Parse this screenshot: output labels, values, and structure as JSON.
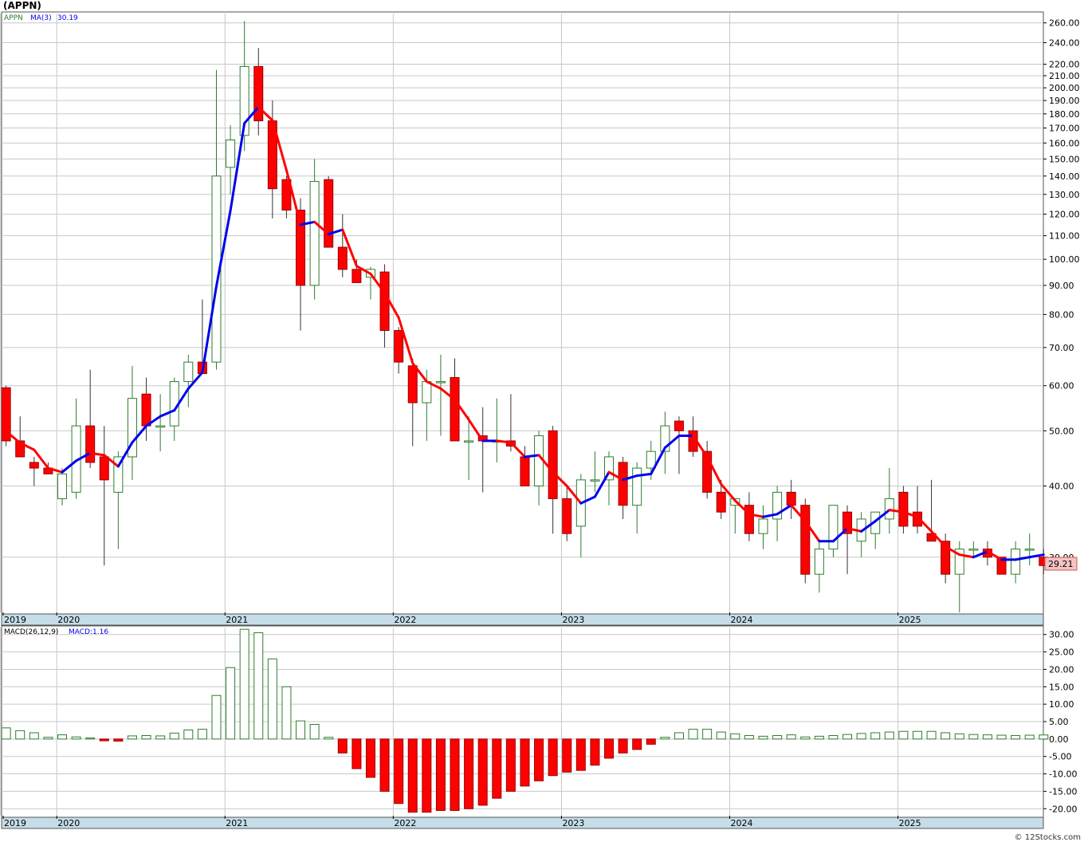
{
  "title": "(APPN)",
  "footer": "© 12Stocks.com",
  "price_panel": {
    "legend_symbol": "APPN",
    "legend_ma": "MA(3)",
    "legend_ma_value": "30.19",
    "last_price_label": "29.21"
  },
  "macd_panel": {
    "legend_params": "MACD(26,12,9)",
    "legend_value": "MACD:1.16"
  },
  "colors": {
    "up": "#2e7d2e",
    "down": "#ff0000",
    "ma_up": "#0000ee",
    "ma_down": "#ff0000",
    "axis_band": "#c5dde8",
    "grid": "#c8c8c8",
    "price_tag_bg": "#f4c4c4"
  },
  "chart_data": [
    {
      "type": "candlestick",
      "scale": "log",
      "ylim": [
        24,
        270
      ],
      "y_ticks": [
        30,
        40,
        50,
        60,
        70,
        80,
        90,
        100,
        110,
        120,
        130,
        140,
        150,
        160,
        170,
        180,
        190,
        200,
        210,
        220,
        240,
        260
      ],
      "x_labels": [
        "2019",
        "2020",
        "2021",
        "2022",
        "2023",
        "2024",
        "2025"
      ],
      "x_label_index": [
        -4,
        0,
        12,
        24,
        36,
        48,
        60
      ],
      "start_index": -4,
      "ohlc": [
        [
          59.5,
          60,
          47,
          48
        ],
        [
          48,
          53,
          45,
          45
        ],
        [
          44,
          45,
          40,
          43
        ],
        [
          43,
          44,
          42,
          42
        ],
        [
          38,
          43,
          37,
          42
        ],
        [
          39,
          57,
          38,
          51
        ],
        [
          51,
          64,
          43,
          44
        ],
        [
          45,
          51,
          29,
          41
        ],
        [
          39,
          46,
          31,
          45
        ],
        [
          45,
          65,
          41,
          57
        ],
        [
          58,
          62,
          48,
          51
        ],
        [
          51,
          58,
          46,
          51
        ],
        [
          51,
          62,
          48,
          61
        ],
        [
          61,
          68,
          55,
          66
        ],
        [
          66,
          85,
          64,
          63
        ],
        [
          66,
          215,
          64,
          140
        ],
        [
          145,
          172,
          130,
          162
        ],
        [
          165,
          262,
          155,
          218
        ],
        [
          218,
          235,
          165,
          175
        ],
        [
          175,
          190,
          118,
          133
        ],
        [
          138,
          140,
          118,
          122
        ],
        [
          122,
          128,
          75,
          90
        ],
        [
          90,
          150,
          85,
          137
        ],
        [
          138,
          140,
          110,
          105
        ],
        [
          105,
          120,
          93,
          96
        ],
        [
          96,
          100,
          92,
          91
        ],
        [
          93,
          97,
          85,
          96
        ],
        [
          95,
          98,
          70,
          75
        ],
        [
          75,
          76,
          63,
          66
        ],
        [
          65,
          67,
          47,
          56
        ],
        [
          56,
          64,
          48,
          61
        ],
        [
          61,
          68,
          49,
          61
        ],
        [
          62,
          67,
          48,
          48
        ],
        [
          48,
          53,
          41,
          48
        ],
        [
          49,
          55,
          39,
          48
        ],
        [
          48,
          57,
          44,
          48
        ],
        [
          48,
          58,
          46,
          47
        ],
        [
          45,
          47,
          40,
          40
        ],
        [
          40,
          50,
          37,
          49
        ],
        [
          50,
          51,
          33,
          38
        ],
        [
          38,
          40,
          32,
          33
        ],
        [
          34,
          42,
          30,
          41
        ],
        [
          41,
          46,
          39,
          41
        ],
        [
          41,
          46,
          37,
          45
        ],
        [
          44,
          45,
          35,
          37
        ],
        [
          37,
          44,
          33,
          43
        ],
        [
          43,
          48,
          41,
          46
        ],
        [
          46,
          54,
          42,
          51
        ],
        [
          52,
          53,
          42,
          50
        ],
        [
          50,
          53,
          45,
          46
        ],
        [
          46,
          48,
          38,
          39
        ],
        [
          39,
          41,
          35,
          36
        ],
        [
          37,
          38,
          33,
          38
        ],
        [
          37,
          39,
          32,
          33
        ],
        [
          33,
          37,
          31,
          35
        ],
        [
          35,
          40,
          32,
          39
        ],
        [
          39,
          41,
          35,
          37
        ],
        [
          37,
          38,
          27,
          28
        ],
        [
          28,
          32,
          26,
          31
        ],
        [
          31,
          37,
          30,
          37
        ],
        [
          36,
          37,
          28,
          33
        ],
        [
          32,
          36,
          30,
          35
        ],
        [
          33,
          36,
          31,
          36
        ],
        [
          35,
          43,
          33,
          38
        ],
        [
          39,
          40,
          33,
          34
        ],
        [
          36,
          40,
          33,
          34
        ],
        [
          33,
          41,
          32,
          32
        ],
        [
          32,
          33,
          27,
          28
        ],
        [
          28,
          32,
          24,
          31
        ],
        [
          31,
          32,
          30,
          31
        ],
        [
          31,
          32,
          29,
          30
        ],
        [
          30,
          30,
          28,
          28
        ],
        [
          28,
          32,
          27,
          31
        ],
        [
          31,
          33,
          29,
          31
        ],
        [
          30,
          31,
          28,
          29
        ]
      ],
      "ma3": [
        49.9,
        47.6,
        46.3,
        43.0,
        42.3,
        44.3,
        45.7,
        45.3,
        43.3,
        47.7,
        51.0,
        53.0,
        54.3,
        59.3,
        63.3,
        89.7,
        121.7,
        173.3,
        185.0,
        175.3,
        143.3,
        115.0,
        116.3,
        110.7,
        112.7,
        97.3,
        94.3,
        87.3,
        79.0,
        65.7,
        61.0,
        59.3,
        56.7,
        52.3,
        48.0,
        48.0,
        47.7,
        45.0,
        45.3,
        42.3,
        40.0,
        37.3,
        38.3,
        42.3,
        41.0,
        41.7,
        42.0,
        46.7,
        49.0,
        49.0,
        45.0,
        40.3,
        37.7,
        35.7,
        35.3,
        35.7,
        37.0,
        34.7,
        32.0,
        32.0,
        33.7,
        33.3,
        34.7,
        36.3,
        36.0,
        35.3,
        33.3,
        31.3,
        30.3,
        30.0,
        30.7,
        29.7,
        29.7,
        30.0,
        30.3
      ],
      "last_price": 29.21
    },
    {
      "type": "bar",
      "name": "MACD",
      "ylim": [
        -22,
        32
      ],
      "y_ticks": [
        30,
        25,
        20,
        15,
        10,
        5,
        0,
        -5,
        -10,
        -15,
        -20
      ],
      "values": [
        3.2,
        2.4,
        1.8,
        0.5,
        1.2,
        0.6,
        0.3,
        -0.5,
        -0.6,
        0.9,
        1.0,
        0.9,
        1.7,
        2.6,
        2.8,
        12.5,
        20.5,
        31.5,
        30.5,
        23.0,
        15.0,
        5.2,
        4.2,
        0.5,
        -4.0,
        -8.5,
        -11.0,
        -15.0,
        -18.5,
        -21.0,
        -21.0,
        -20.5,
        -20.5,
        -20.0,
        -19.0,
        -17.0,
        -15.0,
        -13.5,
        -12.0,
        -10.5,
        -9.5,
        -9.0,
        -7.5,
        -5.5,
        -4.0,
        -3.0,
        -1.5,
        0.5,
        1.8,
        2.8,
        2.8,
        2.0,
        1.5,
        1.0,
        0.8,
        1.0,
        1.2,
        0.6,
        0.8,
        1.0,
        1.3,
        1.6,
        1.8,
        2.0,
        2.2,
        2.2,
        2.2,
        1.8,
        1.5,
        1.3,
        1.2,
        1.1,
        1.0,
        1.1,
        1.16
      ],
      "x_labels": [
        "2019",
        "2020",
        "2021",
        "2022",
        "2023",
        "2024",
        "2025"
      ]
    }
  ]
}
